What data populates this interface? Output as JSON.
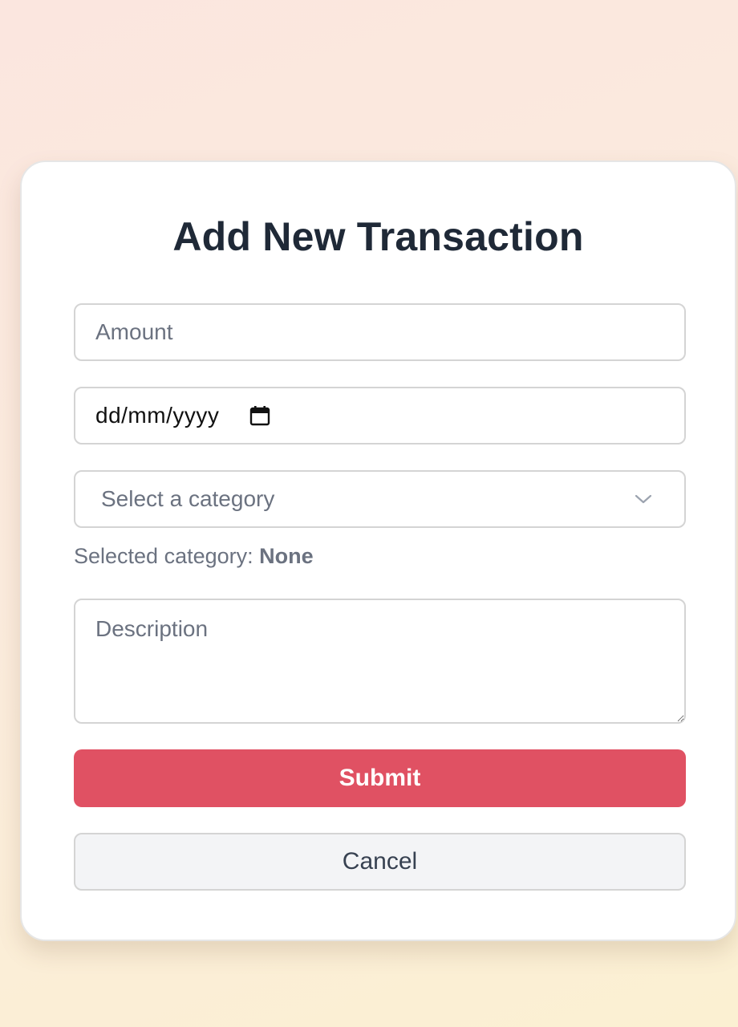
{
  "form": {
    "title": "Add New Transaction",
    "amount_placeholder": "Amount",
    "date_placeholder": "dd/mm/yyyy",
    "calendar_icon": "calendar-icon",
    "category_placeholder": "Select a category",
    "chevron_icon": "chevron-down-icon",
    "selected_category_label": "Selected category:",
    "selected_category_value": "None",
    "description_placeholder": "Description",
    "submit_label": "Submit",
    "cancel_label": "Cancel"
  },
  "colors": {
    "submit_bg": "#e05163",
    "title_text": "#1f2937",
    "muted_text": "#6b7280"
  }
}
